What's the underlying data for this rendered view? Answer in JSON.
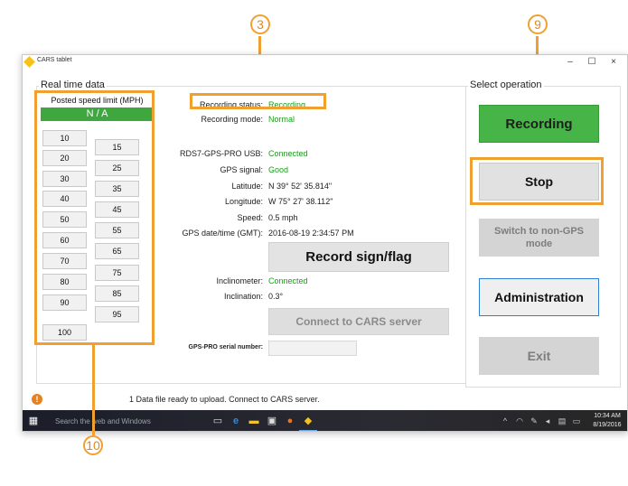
{
  "window": {
    "title": "CARS tablet",
    "minimize": "–",
    "maximize": "☐",
    "close": "×"
  },
  "callouts": {
    "recording_status": "3",
    "stop": "9",
    "speed_panel": "10"
  },
  "realtime": {
    "group_label": "Real time data",
    "speed_limit_label": "Posted speed limit (MPH)",
    "speed_limit_value": "N / A",
    "speeds_left": [
      "10",
      "20",
      "30",
      "40",
      "50",
      "60",
      "70",
      "80",
      "90",
      "100"
    ],
    "speeds_right": [
      "15",
      "25",
      "35",
      "45",
      "55",
      "65",
      "75",
      "85",
      "95"
    ]
  },
  "status": {
    "recording_status_label": "Recording status:",
    "recording_status_value": "Recording",
    "recording_mode_label": "Recording mode:",
    "recording_mode_value": "Normal",
    "usb_label": "RDS7-GPS-PRO USB:",
    "usb_value": "Connected",
    "gps_signal_label": "GPS signal:",
    "gps_signal_value": "Good",
    "latitude_label": "Latitude:",
    "latitude_value": "N 39° 52' 35.814\"",
    "longitude_label": "Longitude:",
    "longitude_value": "W 75° 27' 38.112\"",
    "speed_label": "Speed:",
    "speed_value": "0.5 mph",
    "gps_datetime_label": "GPS date/time (GMT):",
    "gps_datetime_value": "2016-08-19 2:34:57 PM",
    "record_sign_button": "Record sign/flag",
    "inclinometer_label": "Inclinometer:",
    "inclinometer_value": "Connected",
    "inclination_label": "Inclination:",
    "inclination_value": "0.3°",
    "connect_button": "Connect to CARS server",
    "serial_label": "GPS-PRO serial number:",
    "serial_value": ""
  },
  "operation": {
    "group_label": "Select operation",
    "recording": "Recording",
    "stop": "Stop",
    "switch_non_gps": "Switch to non-GPS mode",
    "administration": "Administration",
    "exit": "Exit"
  },
  "statusbar": {
    "icon": "!",
    "message": "1 Data file ready to upload.  Connect to CARS server."
  },
  "taskbar": {
    "search_placeholder": "Search the web and Windows",
    "time": "10:34 AM",
    "date": "8/19/2016"
  },
  "colors": {
    "accent": "#f0a030",
    "recording_green": "#46b446",
    "status_green": "#18a018",
    "admin_border": "#2f7fd6"
  }
}
